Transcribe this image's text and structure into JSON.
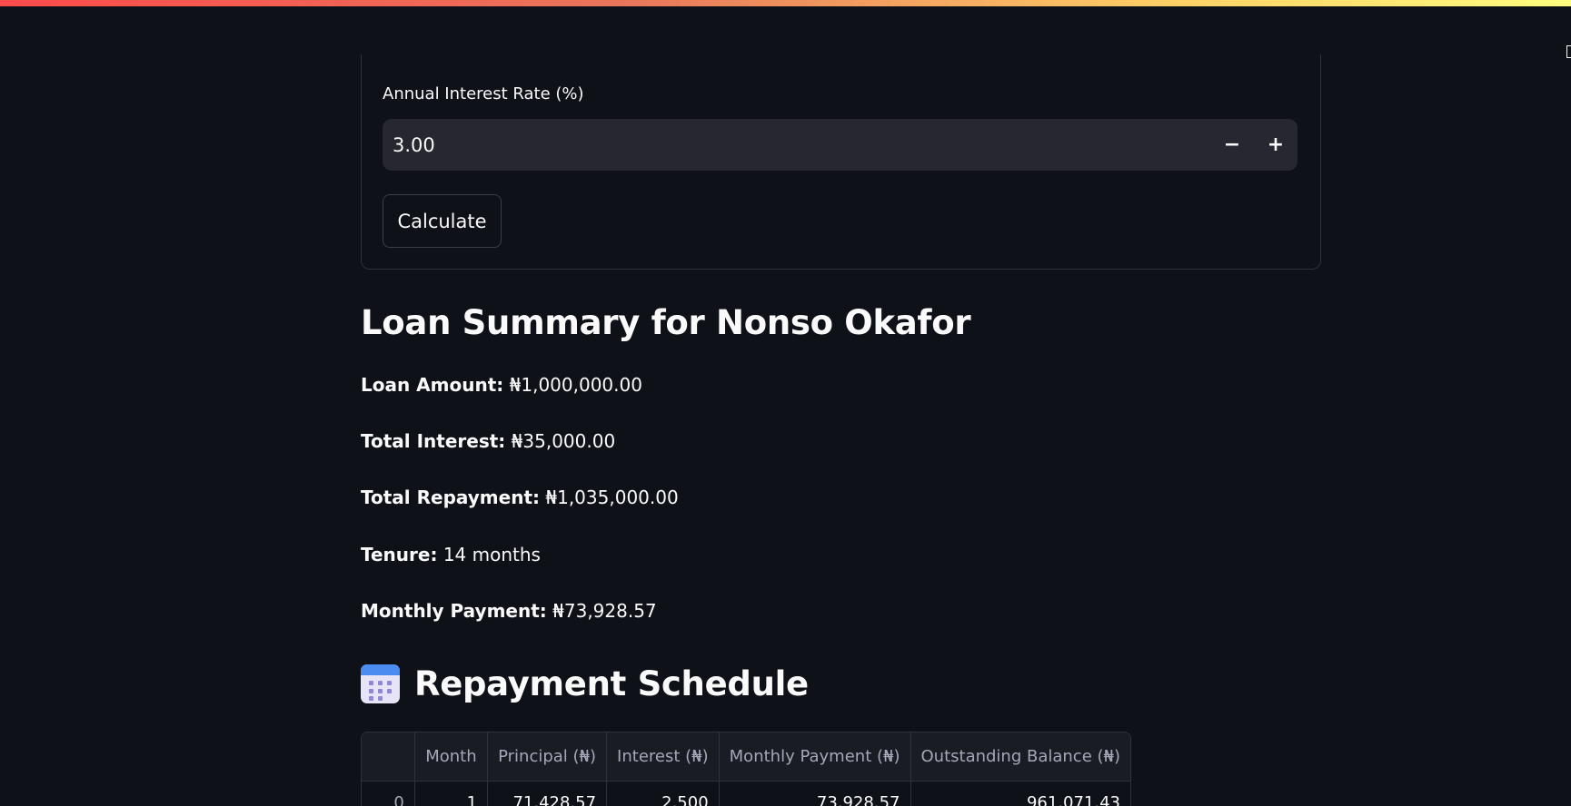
{
  "form": {
    "interest_label": "Annual Interest Rate (%)",
    "interest_value": "3.00",
    "decrement_symbol": "−",
    "increment_symbol": "+",
    "calculate_label": "Calculate"
  },
  "summary": {
    "title": "Loan Summary for Nonso Okafor",
    "items": [
      {
        "label": "Loan Amount:",
        "value": "₦1,000,000.00"
      },
      {
        "label": "Total Interest:",
        "value": "₦35,000.00"
      },
      {
        "label": "Total Repayment:",
        "value": "₦1,035,000.00"
      },
      {
        "label": "Tenure:",
        "value": "14 months"
      },
      {
        "label": "Monthly Payment:",
        "value": "₦73,928.57"
      }
    ]
  },
  "schedule": {
    "icon": "calendar-icon",
    "title": "Repayment Schedule",
    "columns": [
      "",
      "Month",
      "Principal (₦)",
      "Interest (₦)",
      "Monthly Payment (₦)",
      "Outstanding Balance (₦)"
    ],
    "rows": [
      [
        "0",
        "1",
        "71,428.57",
        "2,500",
        "73,928.57",
        "961,071.43"
      ]
    ]
  },
  "colors": {
    "background": "#0e1117",
    "input_background": "#262730",
    "border": "#2f323b",
    "text": "#fafafa",
    "muted_text": "#a3a8b8"
  }
}
